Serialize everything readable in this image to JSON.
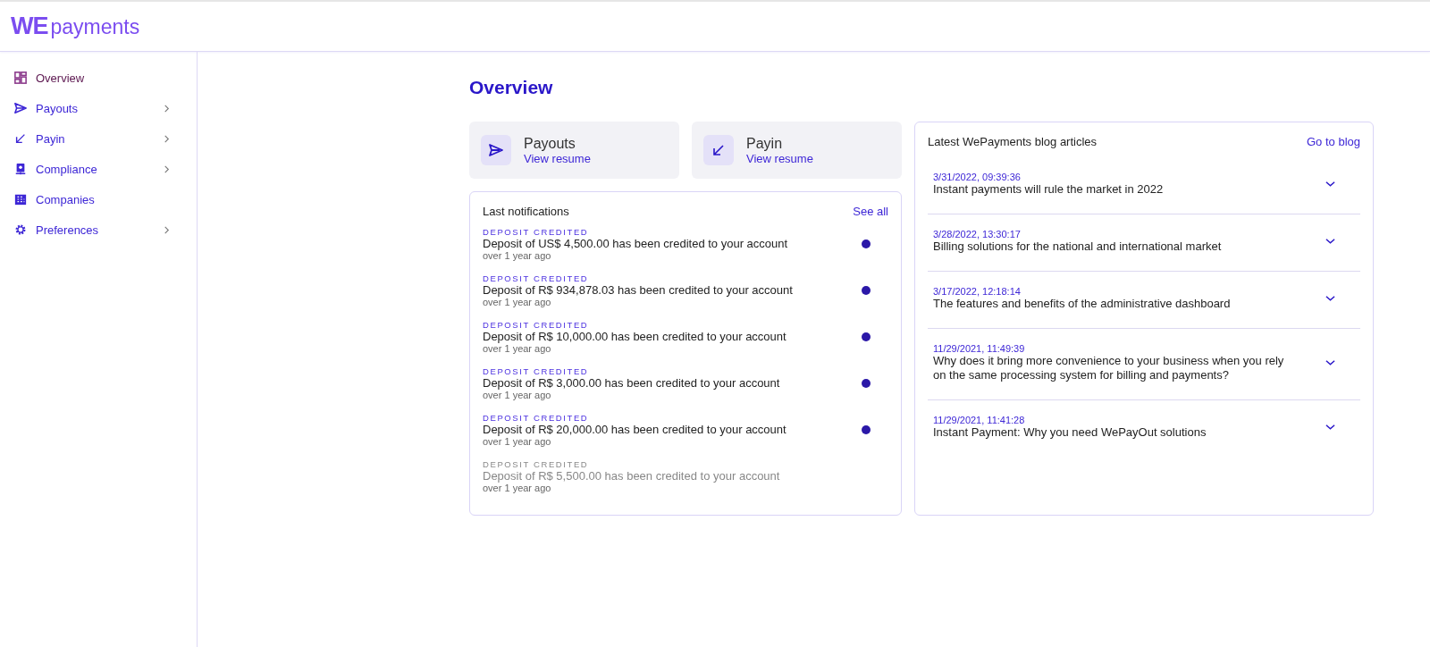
{
  "header": {
    "logo_mark": "WE",
    "logo_text": "payments"
  },
  "sidebar": {
    "items": [
      {
        "label": "Overview",
        "kind": "grid",
        "selected": true,
        "has_submenu": false
      },
      {
        "label": "Payouts",
        "kind": "send",
        "selected": false,
        "has_submenu": true
      },
      {
        "label": "Payin",
        "kind": "arrow",
        "selected": false,
        "has_submenu": true
      },
      {
        "label": "Compliance",
        "kind": "monitor",
        "selected": false,
        "has_submenu": true
      },
      {
        "label": "Companies",
        "kind": "building",
        "selected": false,
        "has_submenu": false
      },
      {
        "label": "Preferences",
        "kind": "gear",
        "selected": false,
        "has_submenu": true
      }
    ]
  },
  "page_title": "Overview",
  "shortcuts": [
    {
      "title": "Payouts",
      "link": "View resume",
      "kind": "send"
    },
    {
      "title": "Payin",
      "link": "View resume",
      "kind": "arrow"
    }
  ],
  "notifications": {
    "title": "Last notifications",
    "link": "See all",
    "items": [
      {
        "type": "DEPOSIT CREDITED",
        "message": "Deposit of US$ 4,500.00 has been credited to your account",
        "time": "over 1 year ago",
        "unread": true
      },
      {
        "type": "DEPOSIT CREDITED",
        "message": "Deposit of R$ 934,878.03 has been credited to your account",
        "time": "over 1 year ago",
        "unread": true
      },
      {
        "type": "DEPOSIT CREDITED",
        "message": "Deposit of R$ 10,000.00 has been credited to your account",
        "time": "over 1 year ago",
        "unread": true
      },
      {
        "type": "DEPOSIT CREDITED",
        "message": "Deposit of R$ 3,000.00 has been credited to your account",
        "time": "over 1 year ago",
        "unread": true
      },
      {
        "type": "DEPOSIT CREDITED",
        "message": "Deposit of R$ 20,000.00 has been credited to your account",
        "time": "over 1 year ago",
        "unread": true
      },
      {
        "type": "DEPOSIT CREDITED",
        "message": "Deposit of R$ 5,500.00 has been credited to your account",
        "time": "over 1 year ago",
        "unread": false
      }
    ]
  },
  "blog": {
    "title": "Latest WePayments blog articles",
    "link": "Go to blog",
    "articles": [
      {
        "date": "3/31/2022, 09:39:36",
        "title": "Instant payments will rule the market in 2022",
        "expanded": false
      },
      {
        "date": "3/28/2022, 13:30:17",
        "title": "Billing solutions for the national and international market",
        "expanded": false
      },
      {
        "date": "3/17/2022, 12:18:14",
        "title": "The features and benefits of the administrative dashboard",
        "expanded": false
      },
      {
        "date": "11/29/2021, 11:49:39",
        "title": "Why does it bring more convenience to your business when you rely on the same processing system for billing and payments?",
        "expanded": false
      },
      {
        "date": "11/29/2021, 11:41:28",
        "title": "Instant Payment: Why you need WePayOut solutions",
        "expanded": false
      }
    ]
  }
}
